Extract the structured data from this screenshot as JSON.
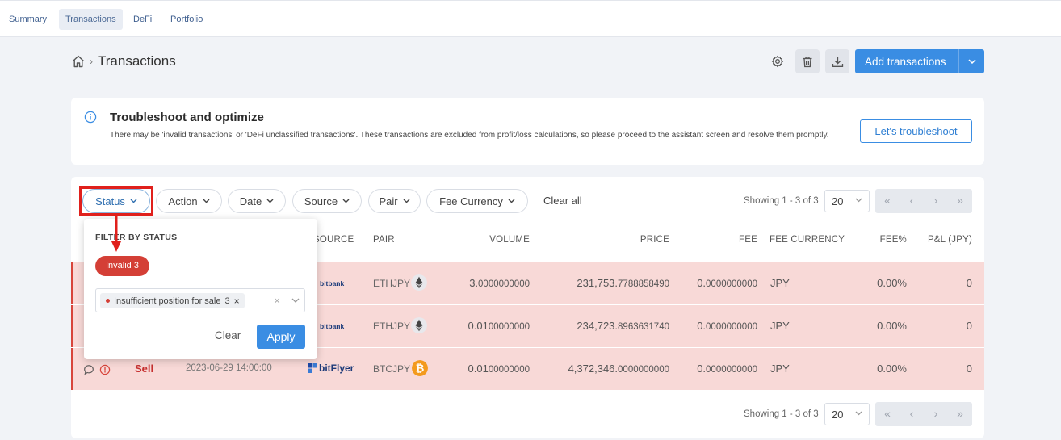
{
  "nav": {
    "tabs": [
      "Summary",
      "Transactions",
      "DeFi",
      "Portfolio"
    ]
  },
  "header": {
    "title": "Transactions",
    "add_label": "Add transactions"
  },
  "notice": {
    "title": "Troubleshoot and optimize",
    "description": "There may be 'invalid transactions' or 'DeFi unclassified transactions'. These transactions are excluded from profit/loss calculations, so please proceed to the assistant screen and resolve them promptly.",
    "button": "Let's troubleshoot"
  },
  "filters": {
    "status": "Status",
    "action": "Action",
    "date": "Date",
    "source": "Source",
    "pair": "Pair",
    "fee_currency": "Fee Currency",
    "clear_all": "Clear all"
  },
  "pagination": {
    "showing": "Showing 1 - 3 of 3",
    "page_size": "20",
    "first": "«",
    "prev": "‹",
    "next": "›",
    "last": "»"
  },
  "table": {
    "headers": {
      "source": "SOURCE",
      "pair": "PAIR",
      "volume": "VOLUME",
      "price": "PRICE",
      "fee": "FEE",
      "fee_currency": "FEE CURRENCY",
      "fee_pct": "FEE%",
      "pnl": "P&L (JPY)"
    },
    "rows": [
      {
        "action": "",
        "date": "",
        "source": "bitbank",
        "pair": "ETHJPY",
        "coin": "eth",
        "volume_int": "3.",
        "volume_dec": "0000000000",
        "price_int": "231,753.",
        "price_dec": "7788858490",
        "fee_int": "0.",
        "fee_dec": "0000000000",
        "fee_currency": "JPY",
        "fee_pct": "0.00%",
        "pnl": "0"
      },
      {
        "action": "",
        "date": "",
        "source": "bitbank",
        "pair": "ETHJPY",
        "coin": "eth",
        "volume_int": "0.01",
        "volume_dec": "00000000",
        "price_int": "234,723.",
        "price_dec": "8963631740",
        "fee_int": "0.",
        "fee_dec": "0000000000",
        "fee_currency": "JPY",
        "fee_pct": "0.00%",
        "pnl": "0"
      },
      {
        "action": "Sell",
        "date": "2023-06-29 14:00:00",
        "source": "bitFlyer",
        "pair": "BTCJPY",
        "coin": "btc",
        "volume_int": "0.01",
        "volume_dec": "00000000",
        "price_int": "4,372,346.",
        "price_dec": "0000000000",
        "fee_int": "0.",
        "fee_dec": "0000000000",
        "fee_currency": "JPY",
        "fee_pct": "0.00%",
        "pnl": "0"
      }
    ]
  },
  "popup": {
    "title": "FILTER BY STATUS",
    "badge": "Invalid 3",
    "tag_label": "Insufficient position for sale",
    "tag_count": "3",
    "tag_remove": "×",
    "clear_x": "×",
    "clear": "Clear",
    "apply": "Apply"
  },
  "colors": {
    "accent": "#3a8de3",
    "invalid": "#d43f36",
    "row_bg": "#f8d9d7",
    "highlight": "#e0201c"
  }
}
